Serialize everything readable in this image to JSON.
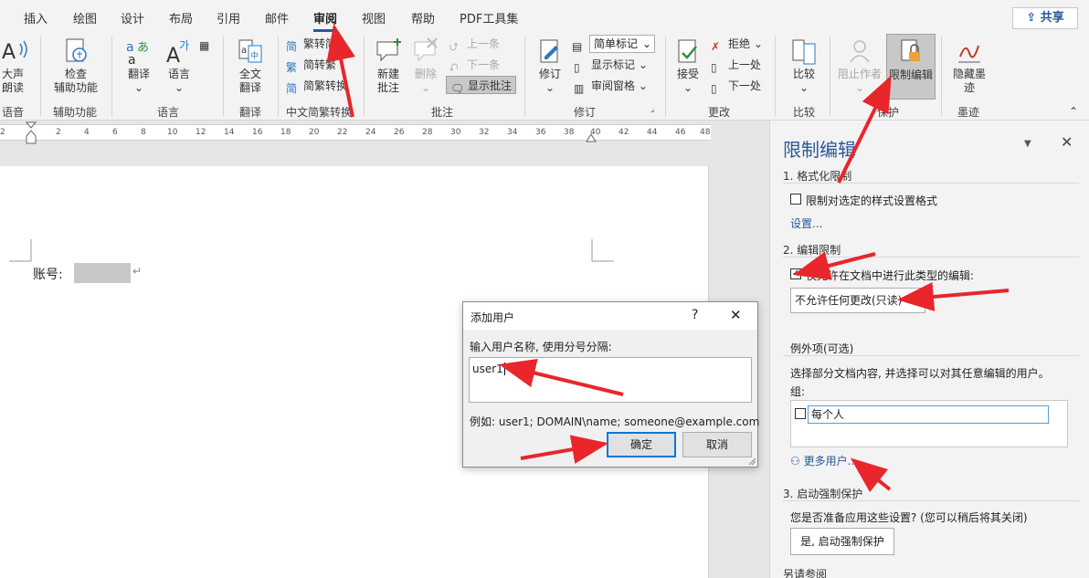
{
  "tabs": [
    "插入",
    "绘图",
    "设计",
    "布局",
    "引用",
    "邮件",
    "审阅",
    "视图",
    "帮助",
    "PDF工具集"
  ],
  "share_label": "共享",
  "ribbon": {
    "speech": {
      "btn": "大声\n朗读",
      "label": "语音"
    },
    "accessibility": {
      "btn": "检查\n辅助功能",
      "label": "辅助功能"
    },
    "language": {
      "translate": "翻译",
      "language": "语言",
      "label": "语言"
    },
    "fulltext": {
      "btn": "全文\n翻译",
      "label": "翻译"
    },
    "chinese": {
      "t2s": "繁转简",
      "s2t": "简转繁",
      "conv": "简繁转换",
      "label": "中文简繁转换"
    },
    "comments": {
      "new": "新建\n批注",
      "delete": "删除",
      "prev": "上一条",
      "next": "下一条",
      "show": "显示批注",
      "label": "批注"
    },
    "tracking": {
      "track": "修订",
      "markup": "简单标记",
      "show_markup": "显示标记",
      "pane": "审阅窗格",
      "label": "修订"
    },
    "changes": {
      "accept": "接受",
      "reject": "拒绝",
      "prev": "上一处",
      "next": "下一处",
      "label": "更改"
    },
    "compare": {
      "btn": "比较",
      "label": "比较"
    },
    "protect": {
      "block": "阻止作者",
      "restrict": "限制编辑",
      "label": "保护"
    },
    "ink": {
      "btn": "隐藏墨\n迹",
      "label": "墨迹"
    }
  },
  "ruler_ticks": [
    "2",
    "2",
    "4",
    "6",
    "8",
    "10",
    "12",
    "14",
    "16",
    "18",
    "20",
    "22",
    "24",
    "26",
    "28",
    "30",
    "32",
    "34",
    "36",
    "38",
    "40",
    "42",
    "44",
    "46",
    "48"
  ],
  "document": {
    "account_label": "账号:",
    "para_mark": "↵"
  },
  "pane": {
    "title": "限制编辑",
    "sec1": "1. 格式化限制",
    "sec1_check": "限制对选定的样式设置格式",
    "settings_link": "设置...",
    "sec2": "2. 编辑限制",
    "sec2_check": "仅允许在文档中进行此类型的编辑:",
    "restrict_value": "不允许任何更改(只读)",
    "exceptions_title": "例外项(可选)",
    "exceptions_desc": "选择部分文档内容, 并选择可以对其任意编辑的用户。",
    "groups_label": "组:",
    "everyone": "每个人",
    "more_users": "更多用户...",
    "sec3": "3. 启动强制保护",
    "sec3_question": "您是否准备应用这些设置? (您可以稍后将其关闭)",
    "enforce_btn": "是, 启动强制保护",
    "see_also": "另请参阅"
  },
  "dialog": {
    "title": "添加用户",
    "help": "?",
    "close": "✕",
    "prompt": "输入用户名称, 使用分号分隔:",
    "input_value": "user1",
    "example": "例如: user1; DOMAIN\\name; someone@example.com",
    "ok": "确定",
    "cancel": "取消"
  },
  "colors": {
    "accent": "#2b579a",
    "arrow": "#e8262b"
  }
}
